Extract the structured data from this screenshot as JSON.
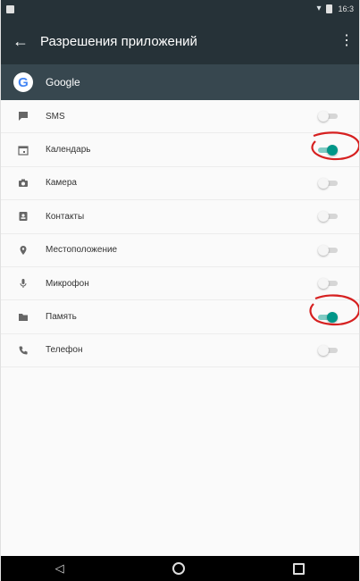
{
  "status_bar": {
    "time": "16:3"
  },
  "toolbar": {
    "title": "Разрешения приложений"
  },
  "app": {
    "name": "Google",
    "logo_letter": "G"
  },
  "permissions": [
    {
      "label": "SMS",
      "icon": "sms-icon",
      "enabled": false
    },
    {
      "label": "Календарь",
      "icon": "calendar-icon",
      "enabled": true
    },
    {
      "label": "Камера",
      "icon": "camera-icon",
      "enabled": false
    },
    {
      "label": "Контакты",
      "icon": "contacts-icon",
      "enabled": false
    },
    {
      "label": "Местоположение",
      "icon": "location-icon",
      "enabled": false
    },
    {
      "label": "Микрофон",
      "icon": "microphone-icon",
      "enabled": false
    },
    {
      "label": "Память",
      "icon": "storage-icon",
      "enabled": true
    },
    {
      "label": "Телефон",
      "icon": "phone-icon",
      "enabled": false
    }
  ],
  "colors": {
    "toolbar_bg": "#263238",
    "app_row_bg": "#37474f",
    "toggle_on": "#009688",
    "annotation_red": "#d62020"
  }
}
